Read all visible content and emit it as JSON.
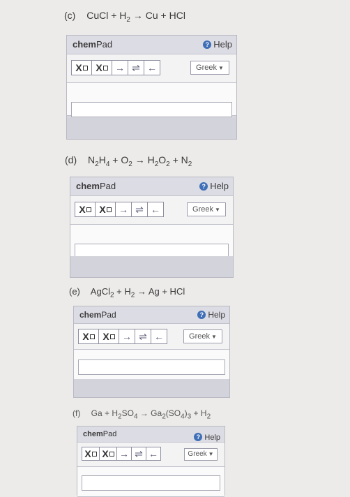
{
  "questions": [
    {
      "label": "(c)",
      "equation": [
        "CuCl",
        " + H",
        "2",
        " → Cu + HCl"
      ],
      "chempad": {
        "title": "chem",
        "title_suffix": "Pad",
        "help": "Help",
        "greek": "Greek"
      }
    },
    {
      "label": "(d)",
      "equation": [
        "N",
        "2",
        "H",
        "4",
        " + O",
        "2",
        " → H",
        "2",
        "O",
        "2",
        " + N",
        "2"
      ],
      "chempad": {
        "title": "chem",
        "title_suffix": "Pad",
        "help": "Help",
        "greek": "Greek"
      }
    },
    {
      "label": "(e)",
      "equation": [
        "AgCl",
        "2",
        " + H",
        "2",
        " → Ag + HCl"
      ],
      "chempad": {
        "title": "chem",
        "title_suffix": "Pad",
        "help": "Help",
        "greek": "Greek"
      }
    },
    {
      "label": "(f)",
      "equation": [
        "Ga + H",
        "2",
        "SO",
        "4",
        " → Ga",
        "2",
        "(SO",
        "4",
        ")",
        "3",
        " + H",
        "2"
      ],
      "chempad": {
        "title": "chem",
        "title_suffix": "Pad",
        "help": "Help",
        "greek": "Greek"
      }
    }
  ],
  "toolbar": {
    "subscript_label": "X",
    "superscript_label": "X",
    "arrow_right": "→",
    "arrow_equilibrium": "⇌",
    "arrow_left": "←"
  },
  "icons": {
    "help": "help-circle-icon",
    "greek_caret": "caret-down-icon"
  }
}
